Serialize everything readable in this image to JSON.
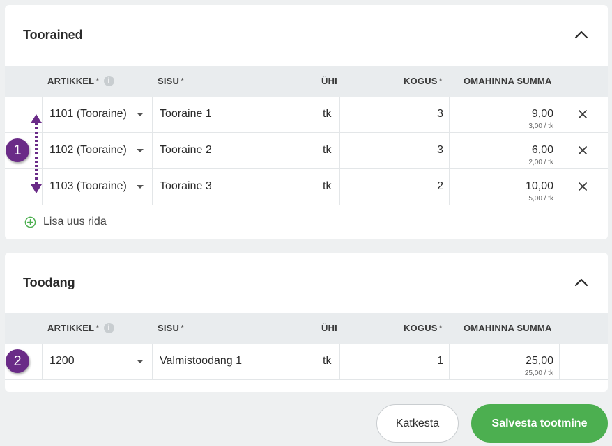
{
  "sections": {
    "tooraine": {
      "title": "Toorained",
      "columns": {
        "artikkel": "ARTIKKEL",
        "sisu": "SISU",
        "uhi": "ÜHI",
        "kogus": "KOGUS",
        "summa": "OMAHINNA SUMMA",
        "required_mark": "*",
        "info_glyph": "i"
      },
      "rows": [
        {
          "artikkel": "1101 (Tooraine)",
          "sisu": "Tooraine 1",
          "uhi": "tk",
          "kogus": "3",
          "summa": "9,00",
          "yksus": "3,00 / tk"
        },
        {
          "artikkel": "1102 (Tooraine)",
          "sisu": "Tooraine 2",
          "uhi": "tk",
          "kogus": "3",
          "summa": "6,00",
          "yksus": "2,00 / tk"
        },
        {
          "artikkel": "1103 (Tooraine)",
          "sisu": "Tooraine 3",
          "uhi": "tk",
          "kogus": "2",
          "summa": "10,00",
          "yksus": "5,00 / tk"
        }
      ],
      "add_row_label": "Lisa uus rida"
    },
    "toodang": {
      "title": "Toodang",
      "columns": {
        "artikkel": "ARTIKKEL",
        "sisu": "SISU",
        "uhi": "ÜHI",
        "kogus": "KOGUS",
        "summa": "OMAHINNA SUMMA",
        "required_mark": "*",
        "info_glyph": "i"
      },
      "rows": [
        {
          "artikkel": "1200",
          "sisu": "Valmistoodang 1",
          "uhi": "tk",
          "kogus": "1",
          "summa": "25,00",
          "yksus": "25,00 / tk"
        }
      ]
    }
  },
  "markers": {
    "one": "1",
    "two": "2"
  },
  "actions": {
    "cancel_label": "Katkesta",
    "save_label": "Salvesta tootmine"
  },
  "colors": {
    "accent_green": "#4caf50",
    "marker_purple": "#6a2b87",
    "header_bg": "#e9ecee",
    "page_bg": "#eef0f1"
  },
  "icons": {
    "collapse": "chevron-up-icon",
    "delete": "close-icon",
    "add": "plus-circle-icon",
    "info": "info-icon",
    "dropdown": "caret-down-icon"
  }
}
